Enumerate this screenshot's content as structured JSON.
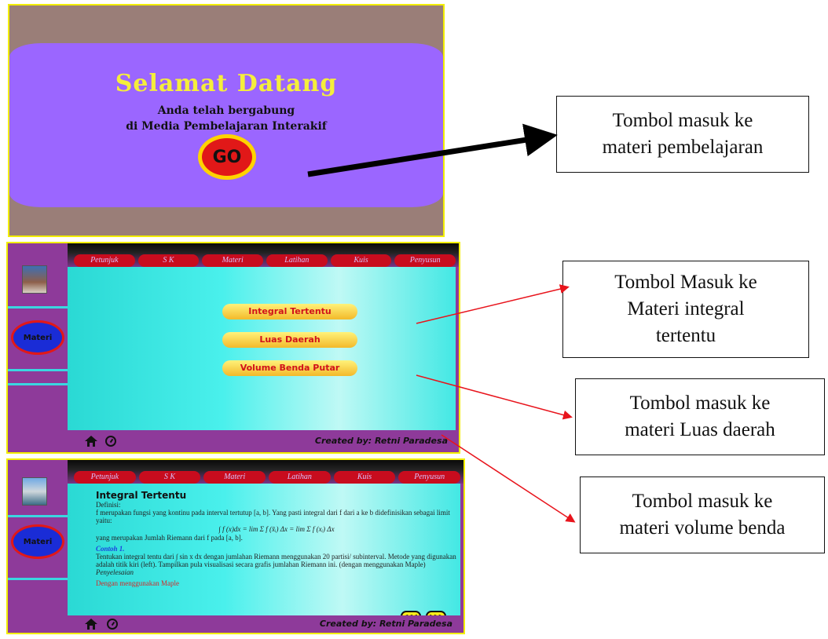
{
  "welcome": {
    "title": "Selamat Datang",
    "line1": "Anda telah bergabung",
    "line2": "di Media Pembelajaran Interakif",
    "go_label": "GO"
  },
  "nav": [
    "Petunjuk",
    "S K",
    "Materi",
    "Latihan",
    "Kuis",
    "Penyusun"
  ],
  "sidebar": {
    "materi_label": "Materi"
  },
  "materi_menu": {
    "integral": "Integral Tertentu",
    "luas": "Luas Daerah",
    "volume": "Volume Benda Putar"
  },
  "credit": "Created by: Retni Paradesa",
  "doc": {
    "heading": "Integral Tertentu",
    "definisi_label": "Definisi:",
    "def_text": "f merupakan fungsi yang kontinu pada interval tertutup [a, b]. Yang pasti integral dari f dari a ke b didefinisikan sebagai limit yaitu:",
    "formula": "∫ f (x)dx = lim Σ f (x̄ᵢ) Δx = lim Σ f (xᵢ) Δx",
    "riemann": "yang merupakan Jumlah Riemann dari f pada [a, b].",
    "contoh": "Contoh 1.",
    "contoh_text": "Tentukan integral tentu dari ∫ sin x dx dengan jumlahan Riemann menggunakan 20 partisi/ subinterval. Metode yang digunakan adalah titik kiri (left). Tampilkan pula visualisasi secara grafis jumlahan Riemann ini. (dengan menggunakan Maple)",
    "penyelesaian": "Penyelesaian",
    "maple": "Dengan menggunakan Maple",
    "prev": "<<<",
    "next": ">>>"
  },
  "callouts": {
    "go": [
      "Tombol masuk ke",
      "materi pembelajaran"
    ],
    "integral": [
      "Tombol Masuk ke",
      "Materi integral",
      "tertentu"
    ],
    "luas": [
      "Tombol masuk ke",
      "materi Luas daerah"
    ],
    "volume": [
      "Tombol masuk ke",
      "materi volume benda"
    ]
  },
  "colors": {
    "arrow_red": "#e8141c",
    "arrow_black": "#000000",
    "pill_text": "#d1121a"
  }
}
